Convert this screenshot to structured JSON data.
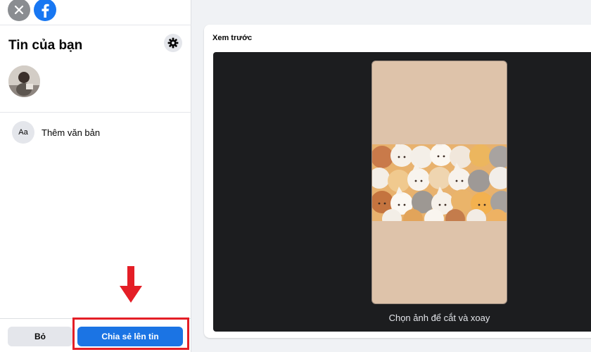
{
  "sidebar": {
    "title": "Tin của bạn",
    "icons": {
      "close": "close-icon",
      "logo": "facebook-logo",
      "settings": "gear-icon"
    },
    "add_text": {
      "icon_text": "Aa",
      "label": "Thêm văn bản"
    },
    "footer": {
      "discard_label": "Bỏ",
      "share_label": "Chia sẻ lên tin"
    }
  },
  "preview": {
    "label": "Xem trước",
    "crop_hint": "Chọn ảnh để cắt và xoay"
  },
  "colors": {
    "accent": "#1b74e4",
    "highlight": "#e41e26",
    "stage": "#1c1d1f",
    "story_bg": "#dec3aa"
  }
}
